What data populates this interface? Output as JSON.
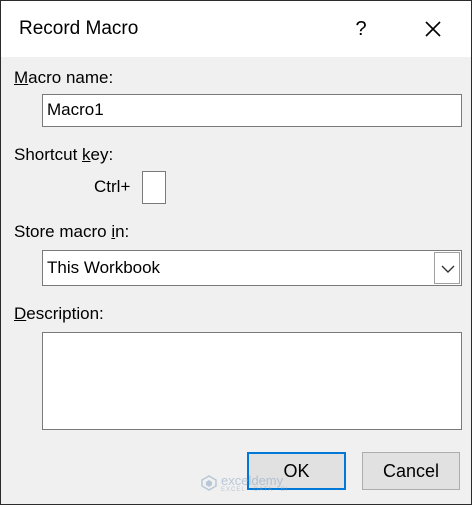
{
  "window": {
    "title": "Record Macro",
    "help_label": "?",
    "close_icon": "close-icon"
  },
  "macro_name": {
    "label_prefix": "M",
    "label_rest": "acro name:",
    "value": "Macro1"
  },
  "shortcut": {
    "label_pre": "Shortcut ",
    "label_ul": "k",
    "label_post": "ey:",
    "ctrl_label": "Ctrl+",
    "value": ""
  },
  "store": {
    "label_pre": "Store macro ",
    "label_ul": "i",
    "label_post": "n:",
    "selected": "This Workbook",
    "arrow_icon": "chevron-down-icon"
  },
  "description": {
    "label_ul": "D",
    "label_rest": "escription:",
    "value": ""
  },
  "buttons": {
    "ok_label": "OK",
    "cancel_label": "Cancel"
  },
  "watermark": {
    "name": "exceldemy",
    "tagline": "EXCEL · DATA · BI"
  },
  "colors": {
    "default_button_border": "#0078d7",
    "dialog_background": "#f0f0f0"
  }
}
